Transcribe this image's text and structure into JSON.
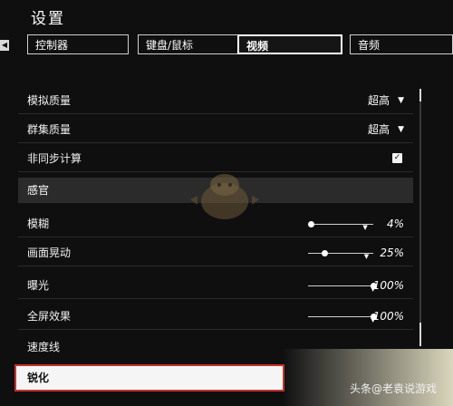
{
  "header": {
    "title": "设置"
  },
  "tabs": [
    {
      "label": "控制器",
      "active": false
    },
    {
      "label": "键盘/鼠标",
      "active": false
    },
    {
      "label": "视频",
      "active": true
    },
    {
      "label": "音频",
      "active": false
    }
  ],
  "settings": {
    "rows": [
      {
        "label": "模拟质量",
        "value": "超高"
      },
      {
        "label": "群集质量",
        "value": "超高"
      },
      {
        "label": "非同步计算",
        "checked": true
      }
    ],
    "section": {
      "label": "感官"
    },
    "sliders": [
      {
        "label": "模糊",
        "percent": 4,
        "display": "4%"
      },
      {
        "label": "画面晃动",
        "percent": 25,
        "display": "25%"
      },
      {
        "label": "曝光",
        "percent": 100,
        "display": "100%"
      },
      {
        "label": "全屏效果",
        "percent": 100,
        "display": "100%"
      }
    ],
    "speed_lines": {
      "label": "速度线"
    },
    "sharpen": {
      "label": "锐化"
    }
  },
  "watermark": {
    "text": "头条@老袁说游戏"
  },
  "colors": {
    "accent_red": "#c3352f",
    "background": "#0f0f10",
    "section_bg": "#2b2b2b"
  }
}
